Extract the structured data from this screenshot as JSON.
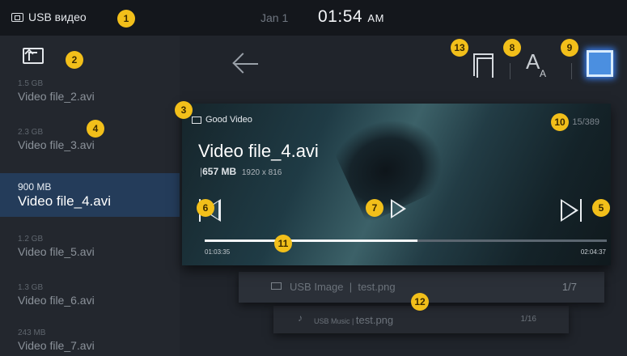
{
  "status_bar": {
    "source_label": "USB видео",
    "date": "Jan 1",
    "time": "01:54",
    "ampm": "AM"
  },
  "file_list": [
    {
      "size": "1.5 GB",
      "name": "Video file_2.avi",
      "active": false
    },
    {
      "size": "2.3 GB",
      "name": "Video file_3.avi",
      "active": false
    },
    {
      "size": "900 MB",
      "name": "Video file_4.avi",
      "active": true
    },
    {
      "size": "1.2 GB",
      "name": "Video file_5.avi",
      "active": false
    },
    {
      "size": "1.3 GB",
      "name": "Video file_6.avi",
      "active": false
    },
    {
      "size": "243 MB",
      "name": "Video file_7.avi",
      "active": false
    }
  ],
  "toolbar": {
    "icons": [
      "back-arrow-icon",
      "aspect-ratio-icon",
      "subtitle-language-icon",
      "window-mode-icon"
    ],
    "subtitle_big": "A",
    "subtitle_small": "A"
  },
  "player_card": {
    "folder": "Good Video",
    "counter": "15/389",
    "title": "Video file_4.avi",
    "meta_bar": "|",
    "meta_size": "657 MB",
    "meta_resolution": "1920 x 816",
    "elapsed": "01:03:35",
    "total": "02:04:37",
    "progress_fraction": 0.53
  },
  "source_rows": [
    {
      "label": "USB Image",
      "sep": "|",
      "file": "test.png",
      "count": "1/7"
    },
    {
      "label": "USB Music",
      "sep": "|",
      "file": "test.png",
      "count": "1/16"
    }
  ],
  "badges": [
    "1",
    "2",
    "3",
    "4",
    "5",
    "6",
    "7",
    "8",
    "9",
    "10",
    "11",
    "12",
    "13"
  ],
  "colors": {
    "accent_badge": "#f2bf1a",
    "active_row": "#243c5a",
    "window_icon_glow": "#4b8fe0"
  }
}
